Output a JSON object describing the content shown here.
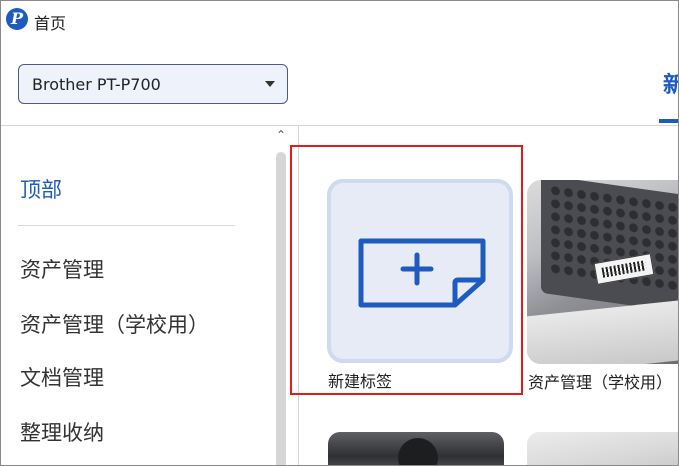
{
  "window": {
    "title": "首页",
    "app_icon_glyph": "P"
  },
  "header": {
    "printer_select_value": "Brother PT-P700",
    "tab_new_label": "新"
  },
  "sidebar": {
    "items": [
      {
        "label": "顶部",
        "active": true
      },
      {
        "label": "资产管理",
        "active": false
      },
      {
        "label": "资产管理（学校用）",
        "active": false
      },
      {
        "label": "文档管理",
        "active": false
      },
      {
        "label": "整理收纳",
        "active": false
      }
    ]
  },
  "content": {
    "new_label_caption": "新建标签",
    "template_caption": "资产管理（学校用）"
  },
  "colors": {
    "accent": "#1e5bbf",
    "highlight": "#e31b1b",
    "card_bg": "#e6ebf6"
  },
  "icons": {
    "app": "brand-p-icon",
    "select_caret": "chevron-down-icon",
    "scroll_up": "chevron-up-icon",
    "new_label": "label-plus-icon"
  }
}
